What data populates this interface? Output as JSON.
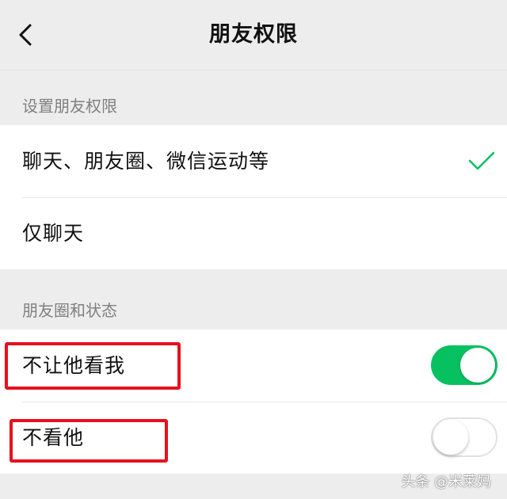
{
  "header": {
    "title": "朋友权限",
    "back_icon": "chevron-left-icon"
  },
  "sections": {
    "permissions": {
      "header": "设置朋友权限",
      "options": [
        {
          "label": "聊天、朋友圈、微信运动等",
          "selected": true
        },
        {
          "label": "仅聊天",
          "selected": false
        }
      ]
    },
    "moments": {
      "header": "朋友圈和状态",
      "toggles": [
        {
          "label": "不让他看我",
          "on": true
        },
        {
          "label": "不看他",
          "on": false
        }
      ]
    }
  },
  "watermark": "头条 @米莱妈",
  "colors": {
    "accent": "#07c160",
    "highlight": "#e8101c",
    "background": "#ededed"
  }
}
